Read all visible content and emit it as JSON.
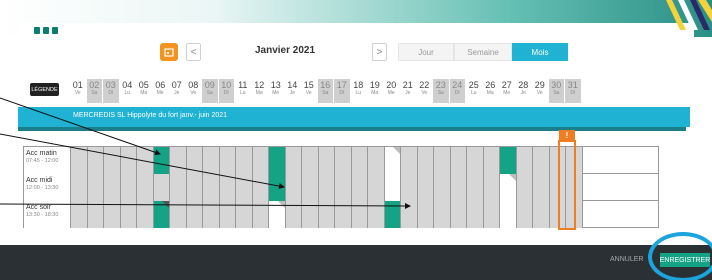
{
  "calendar": {
    "month_label": "Janvier 2021",
    "prev": "<",
    "next": ">",
    "views": [
      "Jour",
      "Semaine",
      "Mois"
    ],
    "active_view": "Mois"
  },
  "legend_label": "LÉGENDE",
  "days": [
    {
      "n": "01",
      "d": "Ve",
      "we": false
    },
    {
      "n": "02",
      "d": "Sa",
      "we": true
    },
    {
      "n": "03",
      "d": "Di",
      "we": true
    },
    {
      "n": "04",
      "d": "Lu",
      "we": false
    },
    {
      "n": "05",
      "d": "Ma",
      "we": false
    },
    {
      "n": "06",
      "d": "Me",
      "we": false
    },
    {
      "n": "07",
      "d": "Je",
      "we": false
    },
    {
      "n": "08",
      "d": "Ve",
      "we": false
    },
    {
      "n": "09",
      "d": "Sa",
      "we": true
    },
    {
      "n": "10",
      "d": "Di",
      "we": true
    },
    {
      "n": "11",
      "d": "Lu",
      "we": false
    },
    {
      "n": "12",
      "d": "Ma",
      "we": false
    },
    {
      "n": "13",
      "d": "Me",
      "we": false
    },
    {
      "n": "14",
      "d": "Je",
      "we": false
    },
    {
      "n": "15",
      "d": "Ve",
      "we": false
    },
    {
      "n": "16",
      "d": "Sa",
      "we": true
    },
    {
      "n": "17",
      "d": "Di",
      "we": true
    },
    {
      "n": "18",
      "d": "Lu",
      "we": false
    },
    {
      "n": "19",
      "d": "Ma",
      "we": false
    },
    {
      "n": "20",
      "d": "Me",
      "we": false
    },
    {
      "n": "21",
      "d": "Je",
      "we": false
    },
    {
      "n": "22",
      "d": "Ve",
      "we": false
    },
    {
      "n": "23",
      "d": "Sa",
      "we": true
    },
    {
      "n": "24",
      "d": "Di",
      "we": true
    },
    {
      "n": "25",
      "d": "Lu",
      "we": false
    },
    {
      "n": "26",
      "d": "Ma",
      "we": false
    },
    {
      "n": "27",
      "d": "Me",
      "we": false
    },
    {
      "n": "28",
      "d": "Je",
      "we": false
    },
    {
      "n": "29",
      "d": "Ve",
      "we": false
    },
    {
      "n": "30",
      "d": "Sa",
      "we": true
    },
    {
      "n": "31",
      "d": "Di",
      "we": true
    }
  ],
  "plan_title": "MERCREDIS SL Hippolyte du fort janv.- juin 2021",
  "rows": [
    {
      "title": "Acc matin",
      "hours": "07:45 - 12:00",
      "green": [
        "06",
        "13",
        "27"
      ],
      "white": [
        "20"
      ],
      "folds": [
        "20"
      ]
    },
    {
      "title": "Acc midi",
      "hours": "12:00 - 13:30",
      "green": [
        "13"
      ],
      "white": [
        "20",
        "27"
      ],
      "folds": [
        "27"
      ]
    },
    {
      "title": "Acc soir",
      "hours": "13:30 - 18:30",
      "green": [
        "06",
        "20"
      ],
      "white": [
        "13",
        "27"
      ],
      "folds": [
        "06",
        "13"
      ]
    }
  ],
  "warning_icon": "!",
  "footer": {
    "cancel_label": "ANNULER",
    "save_label": "ENREGISTRER"
  },
  "colors": {
    "accent": "#1fb2d3",
    "booked": "#14a384",
    "warning": "#ef7d22",
    "footer": "#2b3035"
  }
}
